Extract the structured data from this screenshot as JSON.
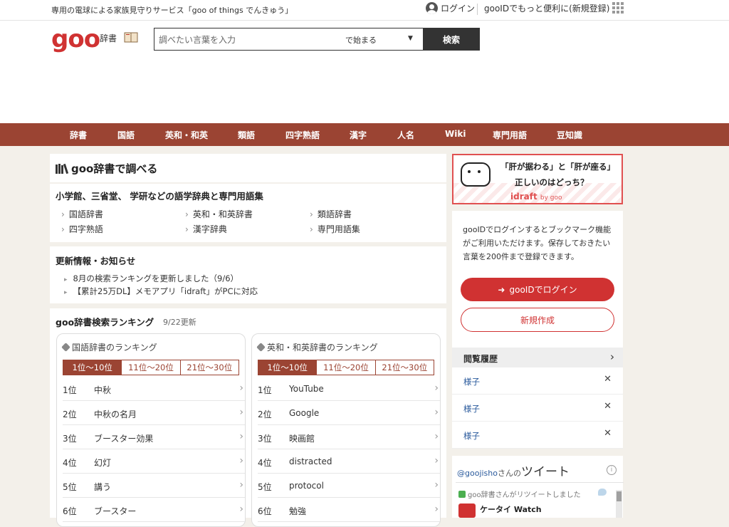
{
  "topbar": {
    "promo": "専用の電球による家族見守りサービス「goo of things でんきゅう」",
    "login": "ログイン",
    "register": "gooIDでもっと便利に(新規登録)"
  },
  "header": {
    "logo": "goo",
    "logo_sub": "辞書",
    "search_placeholder": "調べたい言葉を入力",
    "search_mode": "で始まる",
    "search_button": "検索"
  },
  "nav": [
    "辞書",
    "国語",
    "英和・和英",
    "類語",
    "四字熟語",
    "漢字",
    "人名",
    "Wiki",
    "専門用語",
    "豆知識"
  ],
  "main": {
    "title": "goo辞書で調べる",
    "dict_heading": "小学館、三省堂、 学研などの語学辞典と専門用語集",
    "dict_links": [
      "国語辞書",
      "英和・和英辞書",
      "類語辞書",
      "四字熟語",
      "漢字辞典",
      "専門用語集"
    ],
    "news_heading": "更新情報・お知らせ",
    "news": [
      "8月の検索ランキングを更新しました（9/6）",
      "【累計25万DL】メモアプリ「idraft」がPCに対応"
    ],
    "ranking_heading": "goo辞書検索ランキング",
    "ranking_date": "9/22更新"
  },
  "rankings": [
    {
      "title": "国語辞書のランキング",
      "tabs": [
        "1位〜10位",
        "11位〜20位",
        "21位〜30位"
      ],
      "rows": [
        {
          "rank": "1位",
          "word": "中秋"
        },
        {
          "rank": "2位",
          "word": "中秋の名月"
        },
        {
          "rank": "3位",
          "word": "ブースター効果"
        },
        {
          "rank": "4位",
          "word": "幻灯"
        },
        {
          "rank": "5位",
          "word": "講う"
        },
        {
          "rank": "6位",
          "word": "ブースター"
        }
      ]
    },
    {
      "title": "英和・和英辞書のランキング",
      "tabs": [
        "1位〜10位",
        "11位〜20位",
        "21位〜30位"
      ],
      "rows": [
        {
          "rank": "1位",
          "word": "YouTube"
        },
        {
          "rank": "2位",
          "word": "Google"
        },
        {
          "rank": "3位",
          "word": "映画館"
        },
        {
          "rank": "4位",
          "word": "distracted"
        },
        {
          "rank": "5位",
          "word": "protocol"
        },
        {
          "rank": "6位",
          "word": "勉強"
        }
      ]
    }
  ],
  "sidebar": {
    "ad_line1": "「肝が据わる」と「肝が座る」",
    "ad_line2": "正しいのはどっち？",
    "ad_brand": "idraft",
    "ad_brand_sub": "by goo",
    "login_text": "gooIDでログインするとブックマーク機能がご利用いただけます。保存しておきたい言葉を200件まで登録できます。",
    "login_button": "gooIDでログイン",
    "signup_button": "新規作成",
    "history_title": "閲覧履歴",
    "history": [
      "様子",
      "様子",
      "様子"
    ],
    "tweet_account": "@goojisho",
    "tweet_suffix": "さんの",
    "tweet_title": "ツイート",
    "retweet": "goo辞書さんがリツイートしました",
    "tweet_author": "ケータイ Watch"
  },
  "colors": {
    "brand": "#d03232",
    "nav": "#9b4433",
    "link": "#2a5a9c"
  }
}
